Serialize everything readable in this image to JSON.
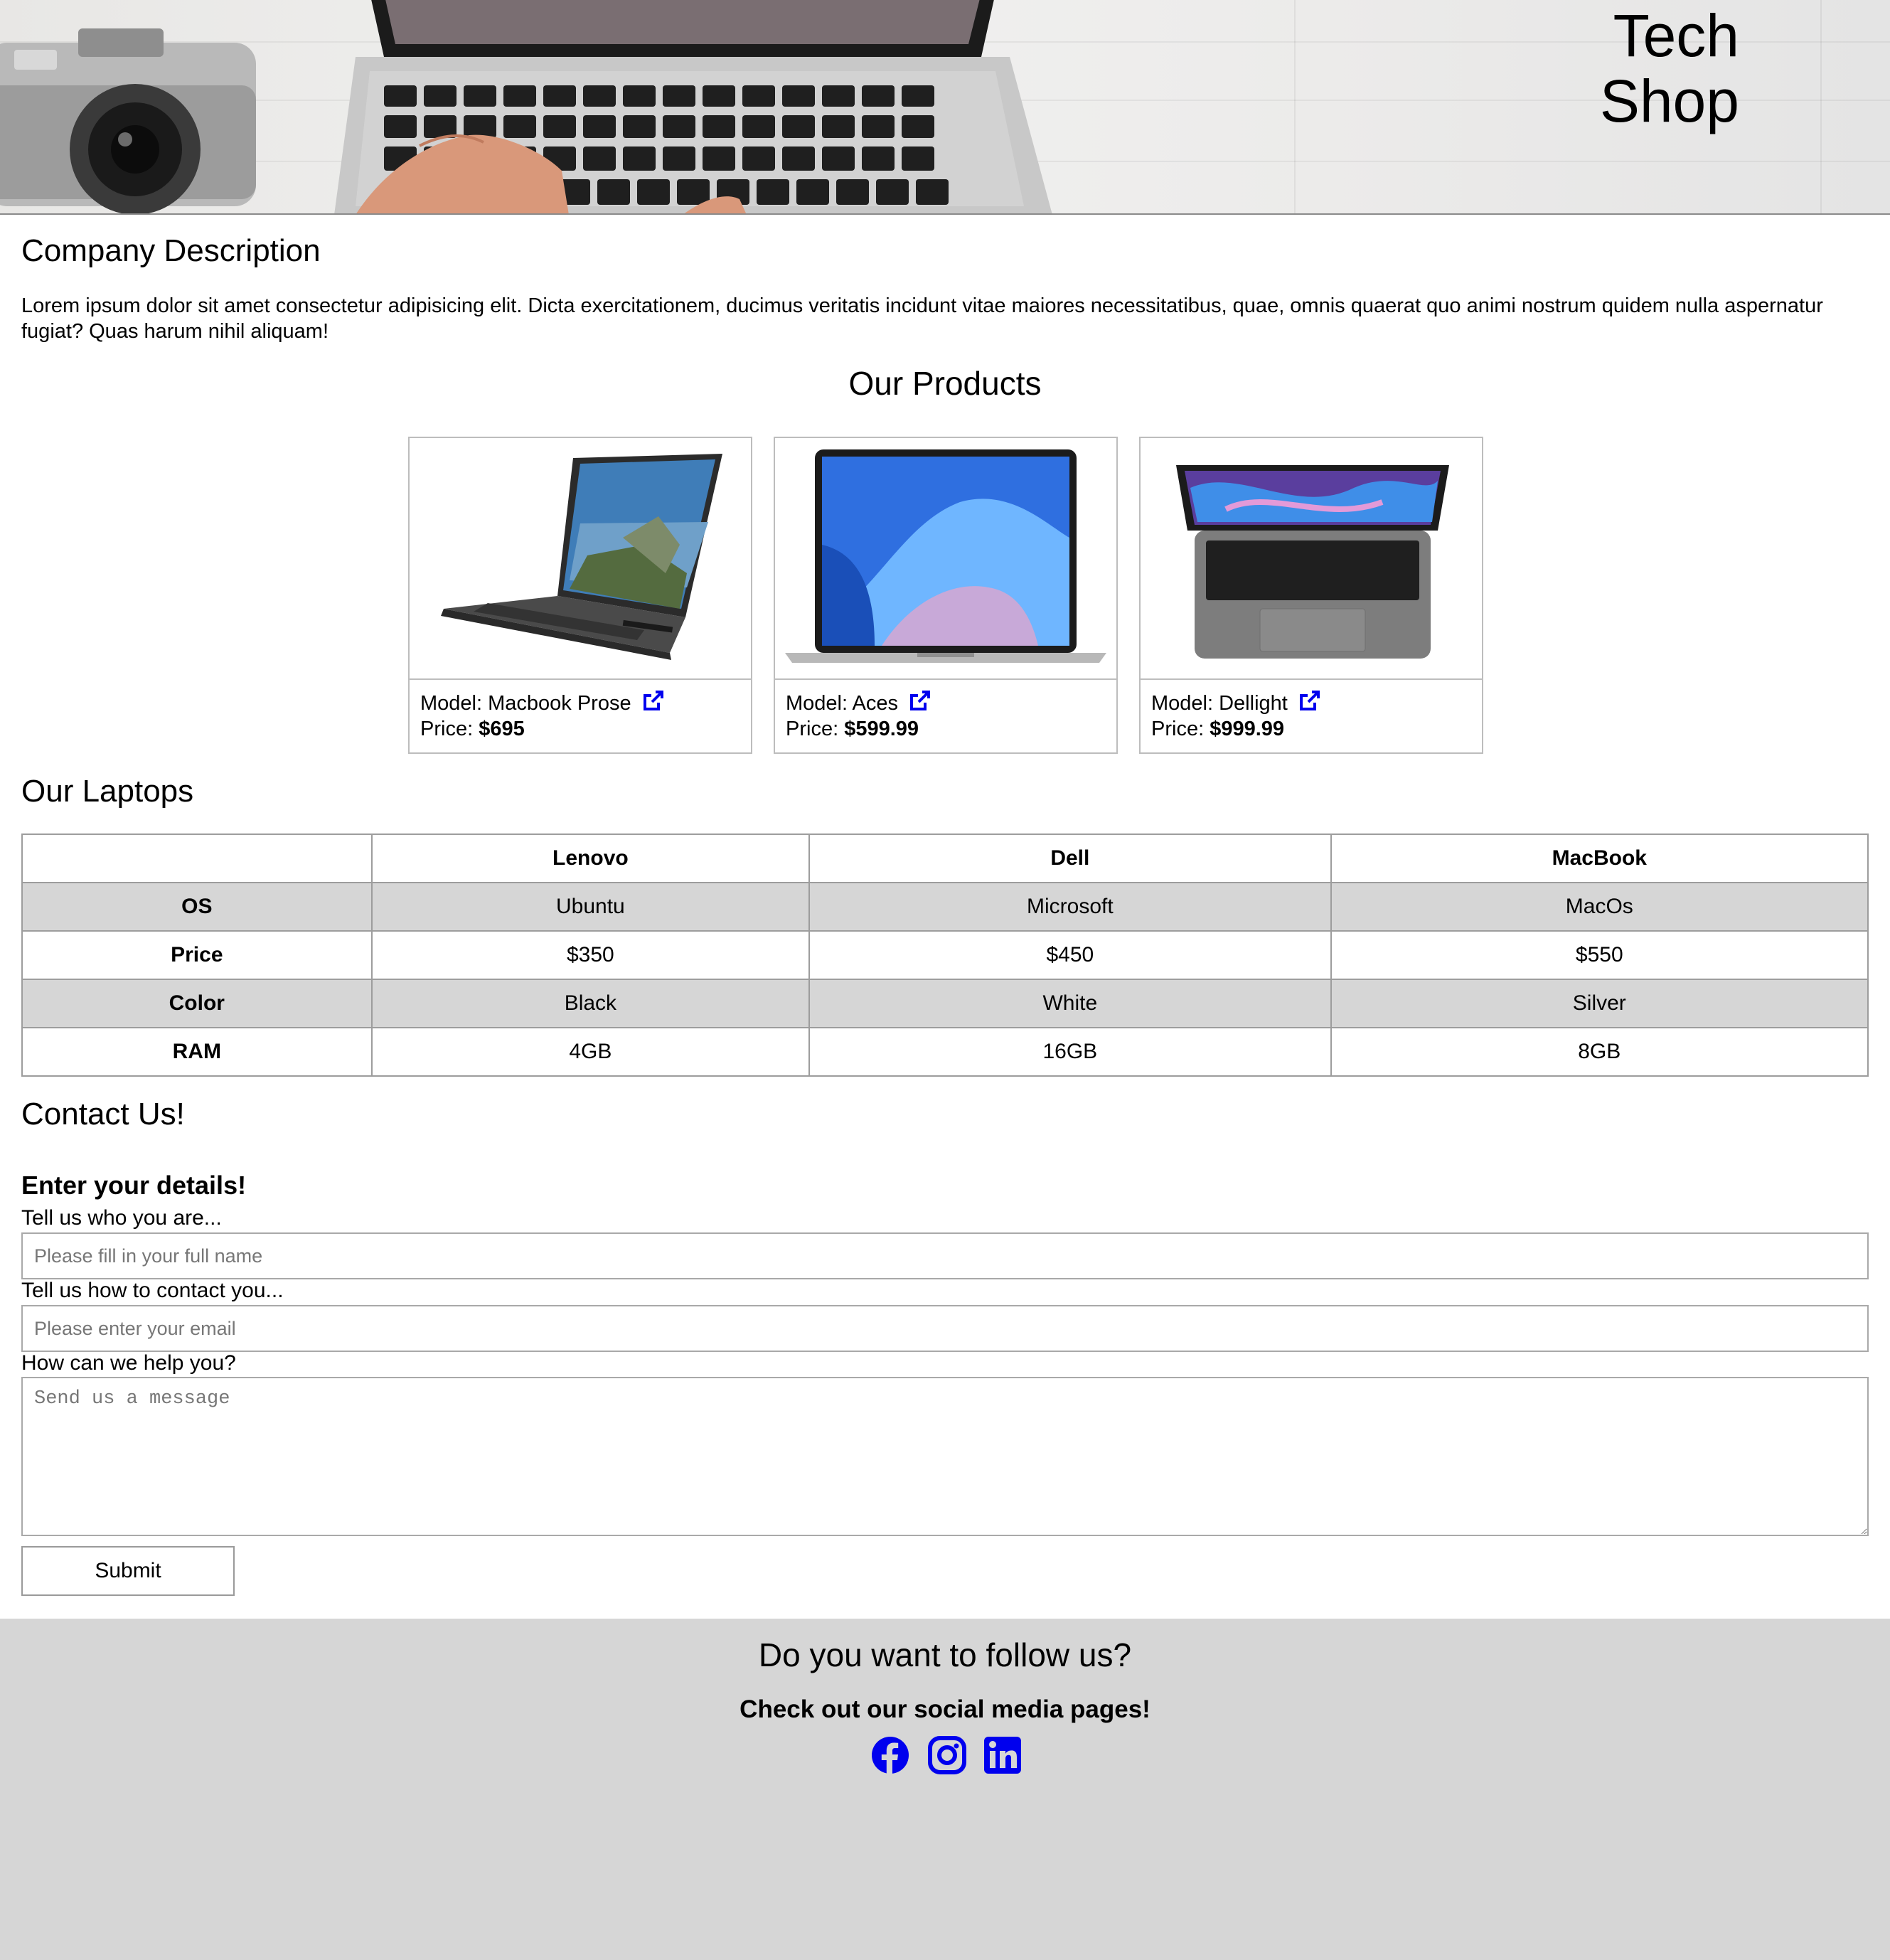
{
  "hero": {
    "title": "Tech Shop"
  },
  "company": {
    "heading": "Company Description",
    "text": "Lorem ipsum dolor sit amet consectetur adipisicing elit. Dicta exercitationem, ducimus veritatis incidunt vitae maiores necessitatibus, quae, omnis quaerat quo animi nostrum quidem nulla aspernatur fugiat? Quas harum nihil aliquam!"
  },
  "products": {
    "heading": "Our Products",
    "items": [
      {
        "model_label": "Model: ",
        "model": "Macbook Prose",
        "price_label": "Price: ",
        "price": "$695"
      },
      {
        "model_label": "Model: ",
        "model": "Aces",
        "price_label": "Price: ",
        "price": "$599.99"
      },
      {
        "model_label": "Model: ",
        "model": "Dellight",
        "price_label": "Price: ",
        "price": "$999.99"
      }
    ]
  },
  "laptops": {
    "heading": "Our Laptops",
    "columns": [
      "",
      "Lenovo",
      "Dell",
      "MacBook"
    ],
    "rows": [
      {
        "label": "OS",
        "values": [
          "Ubuntu",
          "Microsoft",
          "MacOs"
        ]
      },
      {
        "label": "Price",
        "values": [
          "$350",
          "$450",
          "$550"
        ]
      },
      {
        "label": "Color",
        "values": [
          "Black",
          "White",
          "Silver"
        ]
      },
      {
        "label": "RAM",
        "values": [
          "4GB",
          "16GB",
          "8GB"
        ]
      }
    ]
  },
  "contact": {
    "heading": "Contact Us!",
    "subheading": "Enter your details!",
    "name_label": "Tell us who you are...",
    "name_placeholder": "Please fill in your full name",
    "email_label": "Tell us how to contact you...",
    "email_placeholder": "Please enter your email",
    "message_label": "How can we help you?",
    "message_placeholder": "Send us a message",
    "submit_label": "Submit"
  },
  "footer": {
    "title": "Do you want to follow us?",
    "subtitle": "Check out our social media pages!",
    "icons": [
      "facebook-icon",
      "instagram-icon",
      "linkedin-icon"
    ]
  },
  "colors": {
    "link": "#0000ee",
    "table_shade": "#d6d6d6",
    "footer_bg": "#d6d6d6"
  }
}
